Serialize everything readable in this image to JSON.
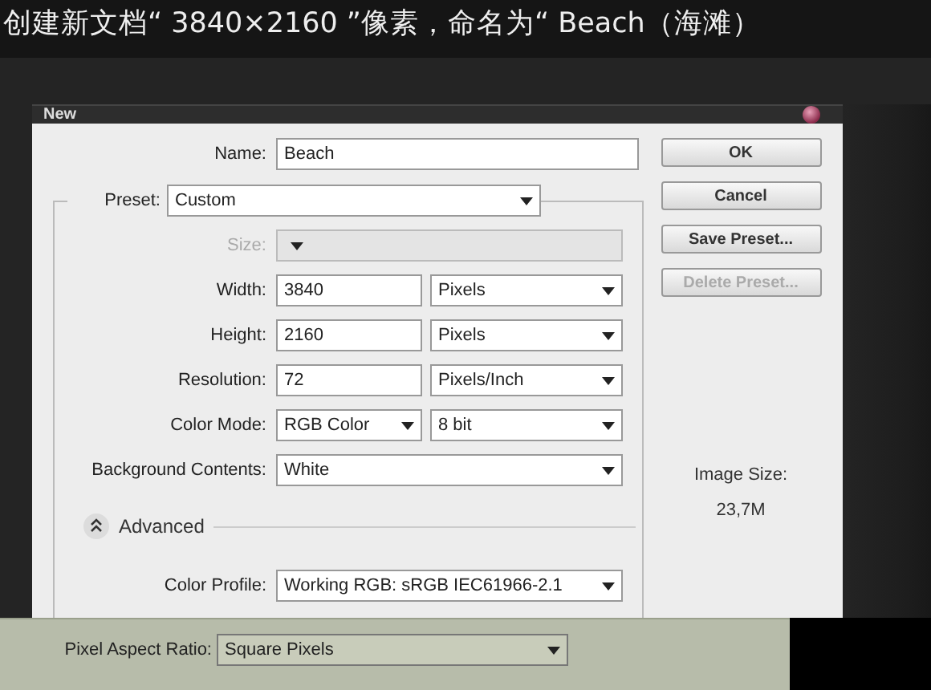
{
  "caption": "创建新文档“ 3840×2160 ”像素，命名为“ Beach（海滩）",
  "dialog": {
    "title": "New",
    "name": {
      "label": "Name:",
      "value": "Beach"
    },
    "preset": {
      "label": "Preset:",
      "value": "Custom"
    },
    "rows": [
      {
        "label": "Size:",
        "disabled": true,
        "controls": [
          {
            "kind": "select"
          }
        ]
      },
      {
        "label": "Width:",
        "disabled": false,
        "controls": [
          {
            "kind": "input",
            "value": "3840"
          },
          {
            "kind": "select",
            "value": "Pixels"
          }
        ]
      },
      {
        "label": "Height:",
        "disabled": false,
        "controls": [
          {
            "kind": "input",
            "value": "2160"
          },
          {
            "kind": "select",
            "value": "Pixels"
          }
        ]
      },
      {
        "label": "Resolution:",
        "disabled": false,
        "controls": [
          {
            "kind": "input",
            "value": "72"
          },
          {
            "kind": "select",
            "value": "Pixels/Inch"
          }
        ]
      },
      {
        "label": "Color Mode:",
        "disabled": false,
        "controls": [
          {
            "kind": "select",
            "value": "RGB Color"
          },
          {
            "kind": "select",
            "value": "8 bit"
          }
        ]
      },
      {
        "label": "Background Contents:",
        "disabled": false,
        "controls": [
          {
            "kind": "select",
            "value": "White"
          }
        ]
      }
    ],
    "advanced": {
      "label": "Advanced",
      "expanded": true
    },
    "color_profile": {
      "label": "Color Profile:",
      "value": "Working RGB:  sRGB IEC61966-2.1"
    },
    "buttons": [
      {
        "label": "OK",
        "disabled": false
      },
      {
        "label": "Cancel",
        "disabled": false
      },
      {
        "label": "Save Preset...",
        "disabled": false
      },
      {
        "label": "Delete Preset...",
        "disabled": true
      }
    ],
    "image_size": {
      "label": "Image Size:",
      "value": "23,7M"
    }
  },
  "pixel_aspect": {
    "label": "Pixel Aspect Ratio:",
    "value": "Square Pixels"
  }
}
